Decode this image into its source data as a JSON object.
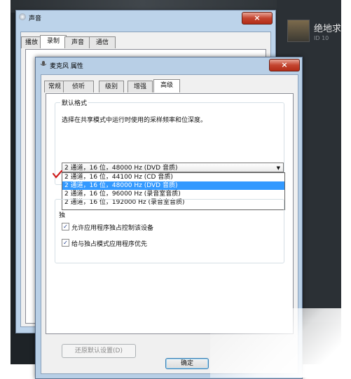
{
  "background_app": {
    "game_name": "绝地求",
    "game_id": "ID 10"
  },
  "sound_window": {
    "title": "声音",
    "close_label": "×",
    "tabs": [
      {
        "label": "播放"
      },
      {
        "label": "录制",
        "selected": true
      },
      {
        "label": "声音"
      },
      {
        "label": "通信"
      }
    ]
  },
  "mic_window": {
    "title": "麦克风 属性",
    "close_label": "×",
    "tabs": [
      {
        "label": "常规"
      },
      {
        "label": "侦听"
      },
      {
        "label": "级别"
      },
      {
        "label": "增强"
      },
      {
        "label": "高级",
        "selected": true
      }
    ],
    "default_format": {
      "group_label": "默认格式",
      "description": "选择在共享模式中运行时使用的采样频率和位深度。",
      "selected_value": "2 通道，16 位，48000 Hz (DVD 音质)",
      "options": [
        {
          "label": "2 通道，16 位，44100 Hz (CD 音质)"
        },
        {
          "label": "2 通道，16 位，48000 Hz (DVD 音质)",
          "highlighted": true
        },
        {
          "label": "2 通道，16 位，96000 Hz (录音室音质)"
        },
        {
          "label": "2 通道，16 位，192000 Hz (录音室音质)"
        }
      ]
    },
    "exclusive_mode": {
      "group_label_partial": "独",
      "allow_exclusive": "允许应用程序独占控制该设备",
      "give_priority": "给与独占模式应用程序优先"
    },
    "restore_defaults": "还原默认设置(D)",
    "ok_label": "确定"
  },
  "colors": {
    "highlight": "#3399ff",
    "annotation_red": "#d0201f"
  }
}
